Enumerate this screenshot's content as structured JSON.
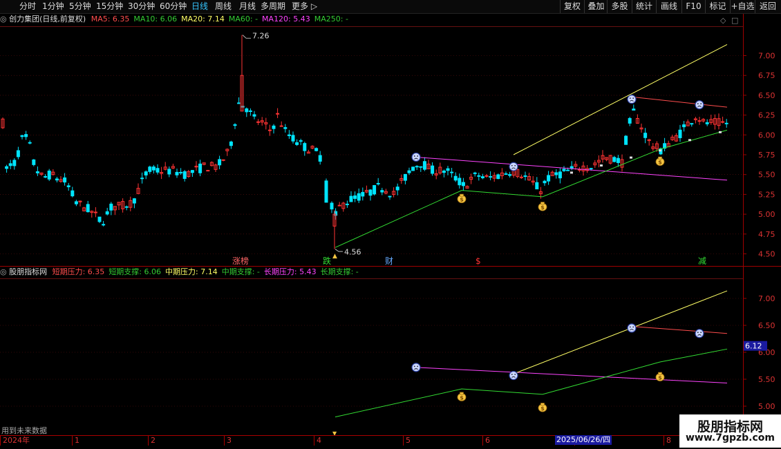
{
  "toolbar": {
    "left": [
      "分时",
      "1分钟",
      "5分钟",
      "15分钟",
      "30分钟",
      "60分钟",
      "日线",
      "周线",
      "月线",
      "多周期",
      "更多 ▷"
    ],
    "active_index": 6,
    "right": [
      "复权",
      "叠加",
      "多股",
      "统计",
      "画线",
      "F10",
      "标记",
      "+自选",
      "返回"
    ]
  },
  "main_legend": {
    "title": "创力集团(日线,前复权)",
    "items": [
      {
        "text": "MA5: 6.35",
        "color": "#ff4d4d"
      },
      {
        "text": "MA10: 6.06",
        "color": "#33cc33"
      },
      {
        "text": "MA20: 7.14",
        "color": "#ffff66"
      },
      {
        "text": "MA60: -",
        "color": "#33cc33"
      },
      {
        "text": "MA120: 5.43",
        "color": "#ff44ff"
      },
      {
        "text": "MA250: -",
        "color": "#33cc33"
      }
    ]
  },
  "ind_legend": {
    "title": "股朋指标网",
    "items": [
      {
        "text": "短期压力: 6.35",
        "color": "#ff4d4d"
      },
      {
        "text": "短期支撑: 6.06",
        "color": "#33cc33"
      },
      {
        "text": "中期压力: 7.14",
        "color": "#ffff66"
      },
      {
        "text": "中期支撑: -",
        "color": "#33cc33"
      },
      {
        "text": "长期压力: 5.43",
        "color": "#ff44ff"
      },
      {
        "text": "长期支撑: -",
        "color": "#33cc33"
      }
    ]
  },
  "main_axis": [
    "7.00",
    "6.75",
    "6.50",
    "6.25",
    "6.00",
    "5.75",
    "5.50",
    "5.25",
    "5.00",
    "4.75",
    "4.50"
  ],
  "ind_axis": [
    "7.00",
    "6.50",
    "6.00",
    "5.50",
    "5.00"
  ],
  "current_value": "6.12",
  "high_label": "7.26",
  "low_label": "4.56",
  "event_tags": [
    {
      "text": "涨榜",
      "color": "#ff6666"
    },
    {
      "text": "跌",
      "color": "#33dd33"
    },
    {
      "text": "财",
      "color": "#66aaff"
    },
    {
      "text": "$",
      "color": "#ff3333"
    },
    {
      "text": "减",
      "color": "#33dd33"
    }
  ],
  "future_note": "用到未来数据",
  "date_labels": [
    "2024年",
    "1",
    "2",
    "3",
    "4",
    "5",
    "6",
    "7",
    "8"
  ],
  "date_badge": "2025/06/26/四",
  "watermark": {
    "line1": "股朋指标网",
    "line2": "www.7gpzb.com"
  },
  "colors": {
    "up": "#ff3333",
    "down": "#00e5ff",
    "short_res": "#ff4d4d",
    "support": "#33dd33",
    "mid_res": "#ffff66",
    "long_res": "#ff44ff",
    "axis": "#a00000",
    "grid": "#661111"
  }
}
